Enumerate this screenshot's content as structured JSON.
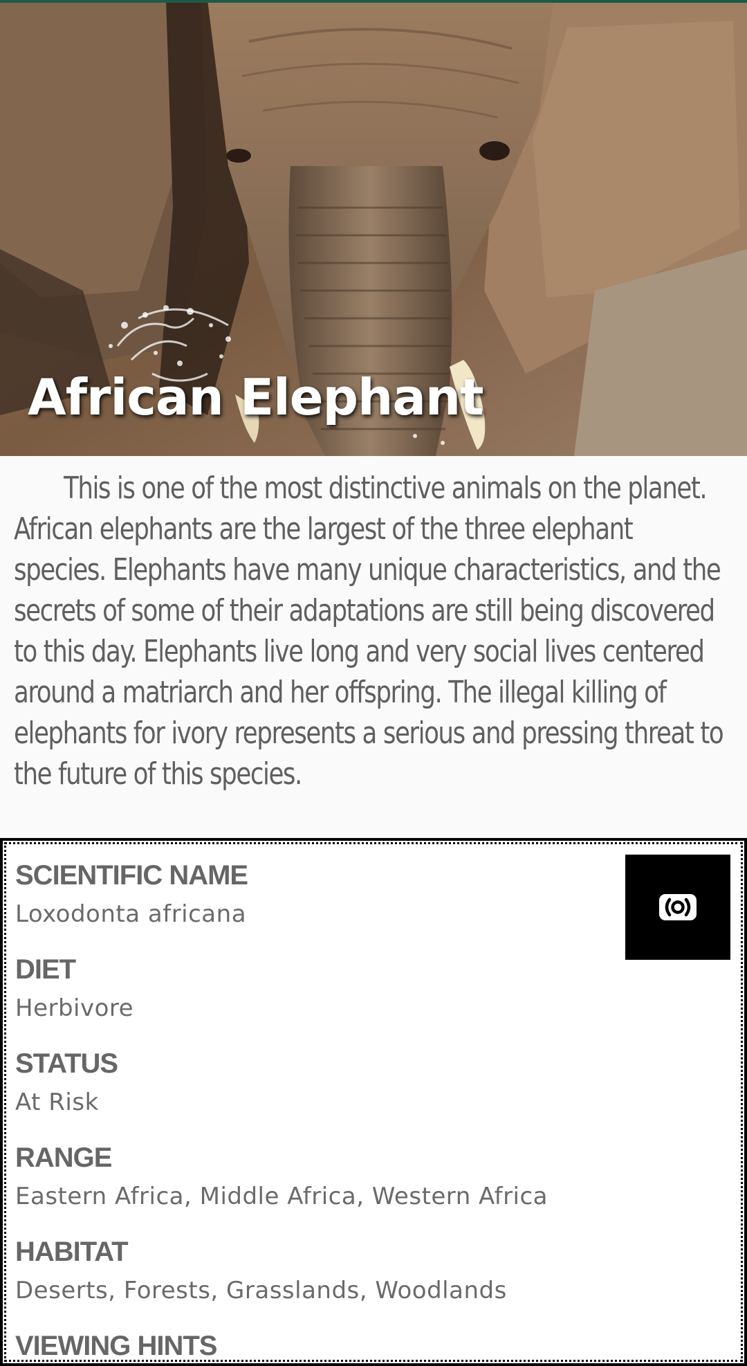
{
  "animal": {
    "name": "African Elephant",
    "description": "This is one of the most distinctive animals on the planet. African elephants are the largest of the three elephant species. Elephants have many unique characteristics, and the secrets of some of their adaptations are still being discovered to this day. Elephants live long and very social lives centered around a matriarch and her offspring. The illegal killing of elephants for ivory represents a serious and pressing threat to the future of this species."
  },
  "facts": {
    "scientific_name": {
      "label": "SCIENTIFIC NAME",
      "value": "Loxodonta africana"
    },
    "diet": {
      "label": "DIET",
      "value": "Herbivore"
    },
    "status": {
      "label": "STATUS",
      "value": "At Risk"
    },
    "range": {
      "label": "RANGE",
      "value": "Eastern Africa, Middle Africa, Western Africa"
    },
    "habitat": {
      "label": "HABITAT",
      "value": "Deserts, Forests, Grasslands, Woodlands"
    },
    "viewing_hints": {
      "label": "VIEWING HINTS"
    }
  },
  "audio_button": {
    "icon": "audio-broadcast-icon"
  },
  "colors": {
    "top_accent": "#1e5a4a",
    "panel_border": "#000000",
    "label_gray": "#666666",
    "body_text": "#5f5f5f"
  }
}
